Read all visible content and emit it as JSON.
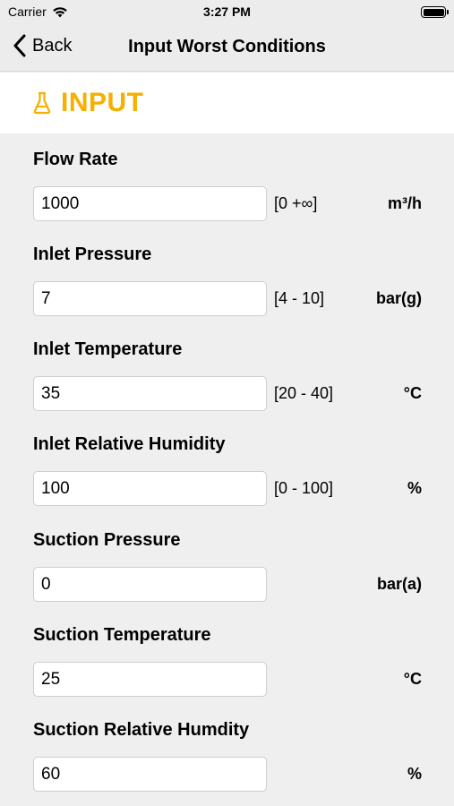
{
  "status_bar": {
    "carrier": "Carrier",
    "time": "3:27 PM"
  },
  "nav": {
    "back_label": "Back",
    "title": "Input Worst Conditions"
  },
  "section": {
    "title": "INPUT",
    "color": "#f5b000"
  },
  "fields": [
    {
      "label": "Flow Rate",
      "value": "1000",
      "range": "[0 +∞]",
      "unit": "m³/h"
    },
    {
      "label": "Inlet Pressure",
      "value": "7",
      "range": "[4 - 10]",
      "unit": "bar(g)"
    },
    {
      "label": "Inlet Temperature",
      "value": "35",
      "range": "[20 - 40]",
      "unit": "°C"
    },
    {
      "label": "Inlet Relative Humidity",
      "value": "100",
      "range": "[0 - 100]",
      "unit": "%"
    },
    {
      "label": "Suction Pressure",
      "value": "0",
      "range": "",
      "unit": "bar(a)"
    },
    {
      "label": "Suction Temperature",
      "value": "25",
      "range": "",
      "unit": "°C"
    },
    {
      "label": "Suction Relative Humdity",
      "value": "60",
      "range": "",
      "unit": "%"
    }
  ]
}
